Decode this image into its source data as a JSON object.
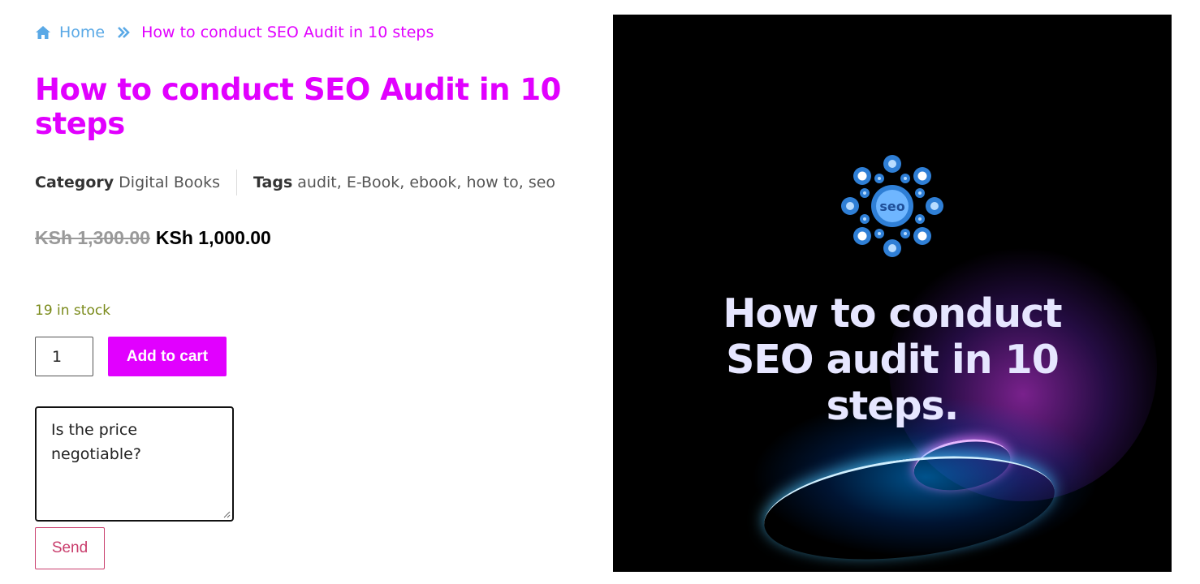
{
  "breadcrumb": {
    "home": "Home",
    "current": "How to conduct SEO Audit in 10 steps"
  },
  "product": {
    "title": "How to conduct SEO Audit in 10 steps",
    "category_label": "Category",
    "category_value": "Digital Books",
    "tags_label": "Tags",
    "tags_value": "audit, E-Book, ebook, how to, seo",
    "old_price": "KSh 1,300.00",
    "new_price": "KSh 1,000.00",
    "stock": "19 in stock"
  },
  "cart": {
    "quantity": "1",
    "add_label": "Add to cart"
  },
  "inquiry": {
    "message_line1": "Is the price",
    "message_line2": "negotiable?",
    "send_label": "Send"
  },
  "hero": {
    "logo_text": "seo",
    "line1": "How to conduct",
    "line2": "SEO audit in 10",
    "line3": "steps."
  },
  "colors": {
    "accent": "#e100ff",
    "link": "#5aa9e6",
    "stock": "#7a8a1a",
    "send": "#c93d6c"
  }
}
